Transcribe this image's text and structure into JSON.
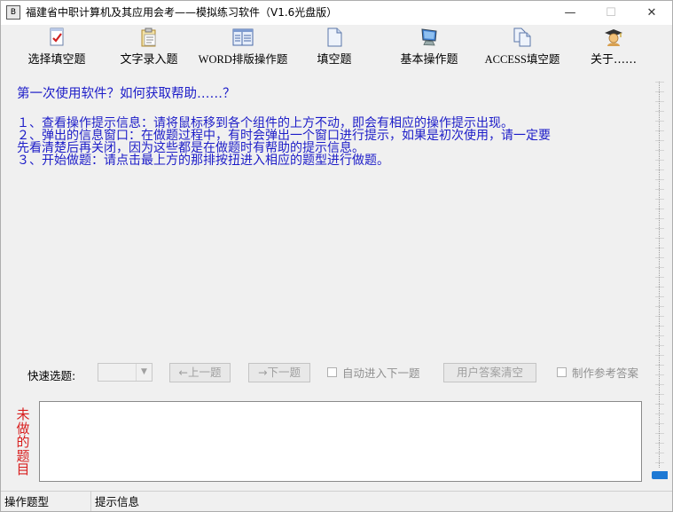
{
  "window": {
    "title": "福建省中职计算机及其应用会考——模拟练习软件（V1.6光盘版）",
    "app_icon_text": "B",
    "controls": {
      "minimize": "—",
      "maximize": "☐",
      "close": "✕"
    }
  },
  "toolbar": {
    "items": [
      {
        "label": "选择填空题",
        "icon": "checklist-icon"
      },
      {
        "label": "文字录入题",
        "icon": "clipboard-icon"
      },
      {
        "label": "WORD排版操作题",
        "icon": "layout-icon"
      },
      {
        "label": "填空题",
        "icon": "document-icon"
      },
      {
        "label": "基本操作题",
        "icon": "monitor-icon"
      },
      {
        "label": "ACCESS填空题",
        "icon": "documents-icon"
      },
      {
        "label": "关于……",
        "icon": "graduate-icon"
      }
    ]
  },
  "help": {
    "question": "第一次使用软件？如何获取帮助……？",
    "lines": [
      "１、查看操作提示信息：请将鼠标移到各个组件的上方不动，即会有相应的操作提示出现。",
      "２、弹出的信息窗口：在做题过程中，有时会弹出一个窗口进行提示，如果是初次使用，请一定要",
      "先看清楚后再关闭，因为这些都是在做题时有帮助的提示信息。",
      "３、开始做题：请点击最上方的那排按扭进入相应的题型进行做题。"
    ]
  },
  "quick_select": {
    "label": "快速选题:",
    "combo_value": "",
    "prev_button": "←上一题",
    "next_button": "→下一题",
    "auto_next_label": "自动进入下一题",
    "auto_next_checked": false,
    "clear_button": "用户答案清空",
    "make_answer_label": "制作参考答案",
    "make_answer_checked": false
  },
  "side_label": "未做的题目",
  "answer_box": {
    "value": ""
  },
  "status": {
    "type_label": "操作题型",
    "info_label": "提示信息"
  },
  "colors": {
    "help_text": "#1c1cc8",
    "side_label": "#d81e1e",
    "scroll_thumb": "#1c78d4"
  }
}
